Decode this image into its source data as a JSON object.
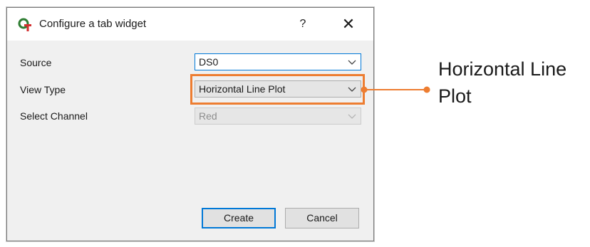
{
  "dialog": {
    "title": "Configure a tab widget",
    "help_glyph": "?",
    "close_glyph": "✕"
  },
  "form": {
    "source": {
      "label": "Source",
      "value": "DS0"
    },
    "view_type": {
      "label": "View Type",
      "value": "Horizontal Line Plot"
    },
    "select_channel": {
      "label": "Select Channel",
      "value": "Red"
    }
  },
  "buttons": {
    "create": "Create",
    "cancel": "Cancel"
  },
  "callout": {
    "line1": "Horizontal Line",
    "line2": "Plot",
    "color": "#ed7d31"
  },
  "icons": {
    "app": "qt-gear-icon",
    "dropdown": "chevron-down-icon"
  }
}
